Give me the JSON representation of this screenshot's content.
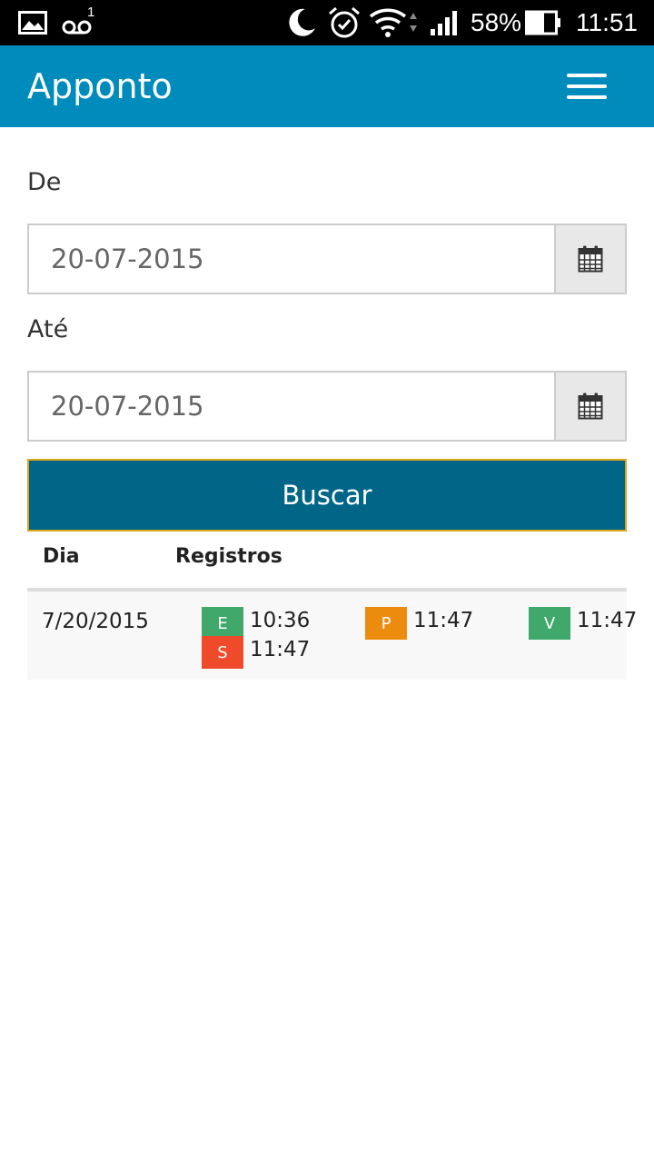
{
  "status": {
    "signal_pct": "58%",
    "time": "11:51",
    "voicemail_count": "1"
  },
  "app": {
    "title": "Apponto",
    "menu_icon": "hamburger-menu-icon"
  },
  "form": {
    "from_label": "De",
    "from_value": "20-07-2015",
    "to_label": "Até",
    "to_value": "20-07-2015",
    "calendar_icon": "calendar-icon",
    "search_label": "Buscar"
  },
  "table": {
    "headers": [
      "Dia",
      "Registros"
    ],
    "rows": [
      {
        "day": "7/20/2015",
        "entries": [
          {
            "type": "E",
            "time": "10:36",
            "color": "#3fa86a"
          },
          {
            "type": "S",
            "time": "11:47",
            "color": "#ef4a2a"
          },
          {
            "type": "P",
            "time": "11:47",
            "color": "#ec8c0e"
          },
          {
            "type": "V",
            "time": "11:47",
            "color": "#3fa86a"
          }
        ]
      }
    ]
  },
  "colors": {
    "appbar": "#008bbd",
    "search_button": "#006587",
    "search_border": "#e0a41b"
  }
}
